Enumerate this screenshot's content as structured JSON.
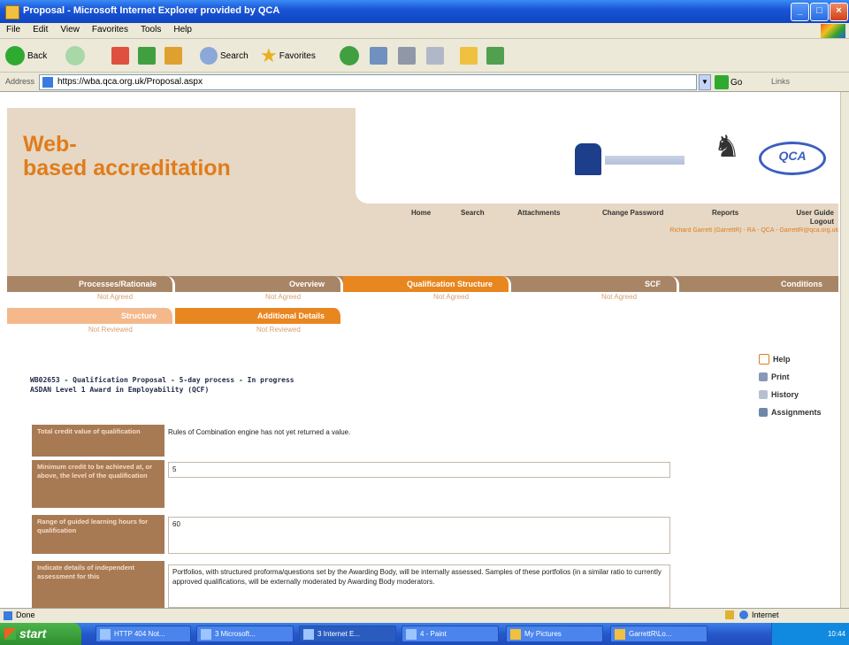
{
  "window": {
    "title": "Proposal - Microsoft Internet Explorer provided by QCA"
  },
  "menubar": [
    "File",
    "Edit",
    "View",
    "Favorites",
    "Tools",
    "Help"
  ],
  "toolbar": {
    "back": "Back",
    "search": "Search",
    "favorites": "Favorites"
  },
  "address": {
    "label": "Address",
    "url": "https://wba.qca.org.uk/Proposal.aspx",
    "go": "Go",
    "links": "Links"
  },
  "header": {
    "brand_line1": "Web-",
    "brand_line2": "based accreditation"
  },
  "nav": {
    "home": "Home",
    "search": "Search",
    "attachments": "Attachments",
    "change_password": "Change Password",
    "reports": "Reports",
    "user_guide": "User Guide",
    "logout": "Logout",
    "user_line": "Richard Garrett (GarrettR) - RA - QCA - GarrettR@qca.org.uk"
  },
  "tabs": [
    {
      "label": "Processes/Rationale",
      "status": "Not Agreed"
    },
    {
      "label": "Overview",
      "status": "Not Agreed"
    },
    {
      "label": "Qualification Structure",
      "status": "Not Agreed"
    },
    {
      "label": "SCF",
      "status": "Not Agreed"
    },
    {
      "label": "Conditions",
      "status": ""
    }
  ],
  "subtabs": [
    {
      "label": "Structure",
      "status": "Not Reviewed"
    },
    {
      "label": "Additional Details",
      "status": "Not Reviewed"
    }
  ],
  "sidebar": [
    "Help",
    "Print",
    "History",
    "Assignments"
  ],
  "proposal": {
    "line1": "WB02653 - Qualification Proposal - 5-day process - In progress",
    "line2": "ASDAN Level 1 Award in Employability (QCF)"
  },
  "form": {
    "total_credit_label": "Total credit value of qualification",
    "total_credit_value": "Rules of Combination engine has not yet returned a value.",
    "min_credit_label": "Minimum credit to be achieved at, or above, the level of the qualification",
    "min_credit_value": "5",
    "glh_label": "Range of guided learning hours for qualification",
    "glh_value": "60",
    "assessment_label": "Indicate details of independent assessment for this",
    "assessment_value": "Portfolios, with structured proforma/questions set by the Awarding Body, will be internally assessed.  Samples of these portfolios (in a similar ratio to currently approved qualifications, will be externally moderated by Awarding Body moderators."
  },
  "statusbar": {
    "text": "Done",
    "zone": "Internet"
  },
  "taskbar": {
    "start": "start",
    "tasks": [
      "HTTP 404 Not...",
      "3 Microsoft...",
      "3 Internet E...",
      "4 - Paint",
      "My Pictures",
      "GarrettR\\Lo..."
    ],
    "clock": "10:44"
  },
  "colors": {
    "accent": "#e8861f",
    "tab_bg": "#a88565",
    "label_bg": "#a87a54"
  }
}
